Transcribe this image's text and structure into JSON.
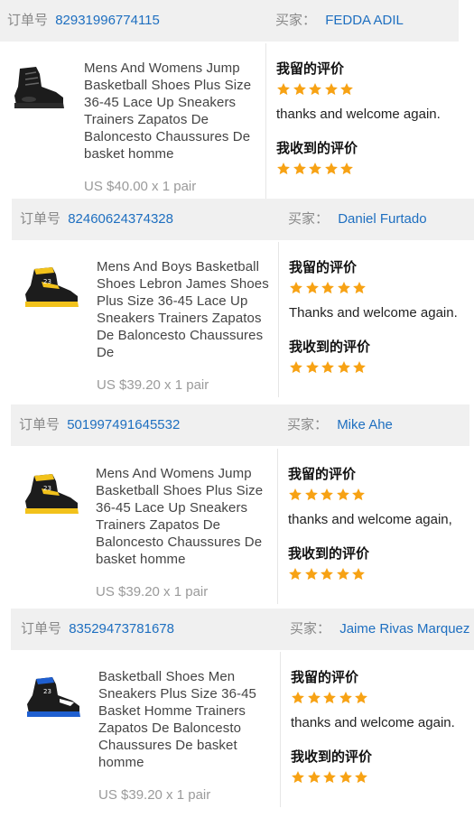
{
  "labels": {
    "order_no": "订单号",
    "buyer": "买家：",
    "my_review": "我留的评价",
    "received_review": "我收到的评价"
  },
  "colors": {
    "star": "#f7a214",
    "link": "#1e6fc0",
    "header_bg": "#f0f0f0"
  },
  "orders": [
    {
      "order_id": "82931996774115",
      "buyer_name": "FEDDA ADIL",
      "product_title": "Mens And Womens Jump Basketball Shoes Plus Size 36-45 Lace Up Sneakers Trainers Zapatos De Baloncesto Chaussures De basket homme",
      "price": "US $40.00 x 1 pair",
      "my_review_stars": 5,
      "my_review_text": "thanks and welcome again.",
      "received_review_stars": 5,
      "product_image": "shoe-black-icon"
    },
    {
      "order_id": "82460624374328",
      "buyer_name": "Daniel Furtado",
      "product_title": "Mens And Boys Basketball Shoes Lebron James Shoes Plus Size 36-45 Lace Up Sneakers Trainers Zapatos De Baloncesto Chaussures De",
      "price": "US $39.20 x 1 pair",
      "my_review_stars": 5,
      "my_review_text": "Thanks and welcome again.",
      "received_review_stars": 5,
      "product_image": "shoe-black-yellow-icon"
    },
    {
      "order_id": "501997491645532",
      "buyer_name": "Mike Ahe",
      "product_title": "Mens And Womens Jump Basketball Shoes Plus Size 36-45 Lace Up Sneakers Trainers Zapatos De Baloncesto Chaussures De basket homme",
      "price": "US $39.20 x 1 pair",
      "my_review_stars": 5,
      "my_review_text": "thanks and welcome again,",
      "received_review_stars": 5,
      "product_image": "shoe-black-yellow-icon"
    },
    {
      "order_id": "83529473781678",
      "buyer_name": "Jaime Rivas Marquez",
      "product_title": "Basketball Shoes Men Sneakers Plus Size 36-45 Basket Homme Trainers Zapatos De Baloncesto Chaussures De basket homme",
      "price": "US $39.20 x 1 pair",
      "my_review_stars": 5,
      "my_review_text": "thanks and welcome again.",
      "received_review_stars": 5,
      "product_image": "shoe-black-blue-icon"
    }
  ]
}
